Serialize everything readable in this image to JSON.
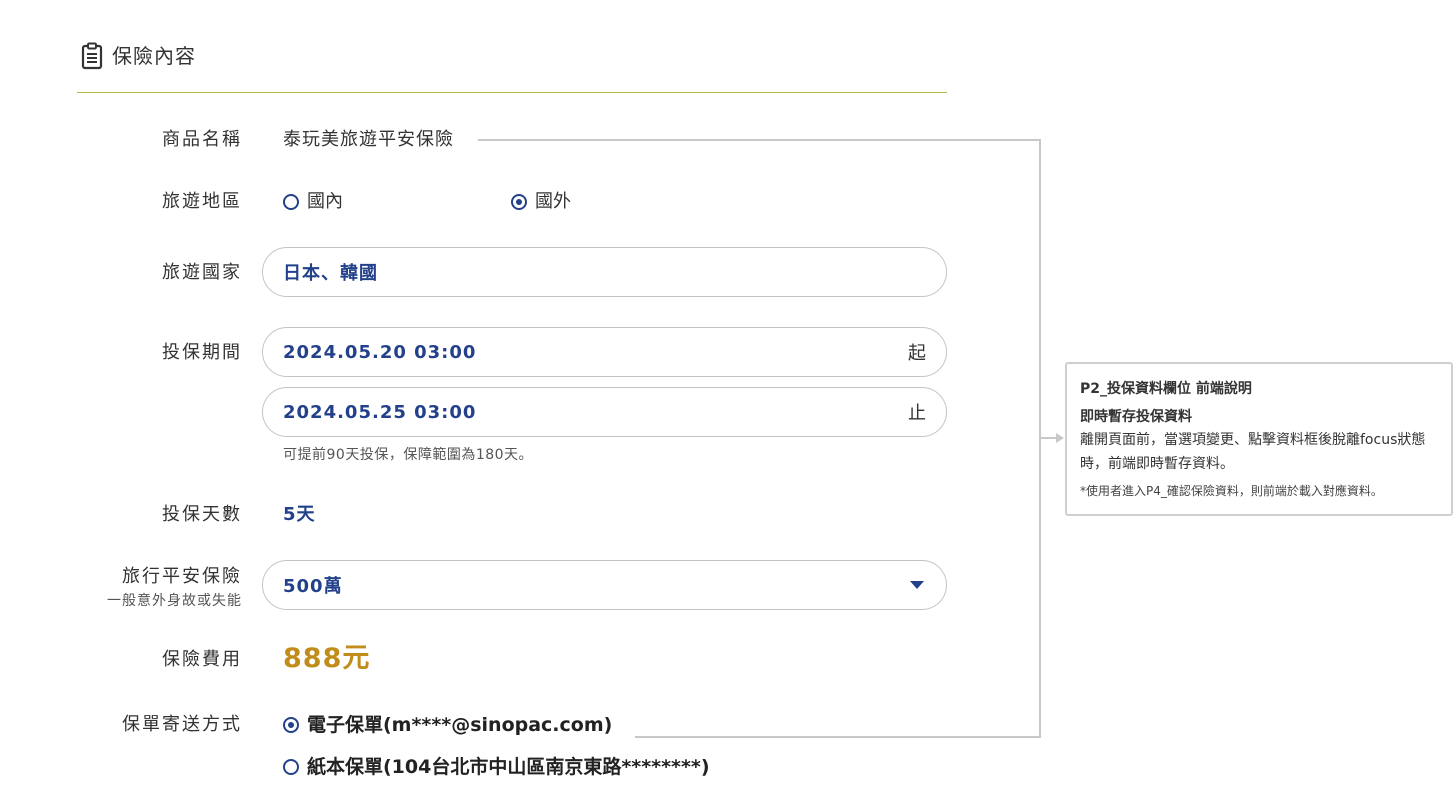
{
  "section": {
    "title": "保險內容",
    "icon": "clipboard-icon",
    "rule_color": "#b9b948"
  },
  "form": {
    "product": {
      "label": "商品名稱",
      "value": "泰玩美旅遊平安保險"
    },
    "region": {
      "label": "旅遊地區",
      "options": [
        {
          "label": "國內",
          "checked": false
        },
        {
          "label": "國外",
          "checked": true
        }
      ]
    },
    "country": {
      "label": "旅遊國家",
      "value": "日本、韓國"
    },
    "period": {
      "label": "投保期間",
      "start": {
        "value": "2024.05.20 03:00",
        "suffix": "起"
      },
      "end": {
        "value": "2024.05.25 03:00",
        "suffix": "止"
      },
      "hint": "可提前90天投保，保障範圍為180天。"
    },
    "days": {
      "label": "投保天數",
      "value": "5天"
    },
    "accident": {
      "label": "旅行平安保險",
      "sublabel": "一般意外身故或失能",
      "value": "500萬",
      "icon": "caret-down-icon"
    },
    "fee": {
      "label": "保險費用",
      "value": "888元",
      "color": "#c08d1a"
    },
    "delivery": {
      "label": "保單寄送方式",
      "options": [
        {
          "label": "電子保單(m****@sinopac.com)",
          "checked": true
        },
        {
          "label": "紙本保單(104台北市中山區南京東路********)",
          "checked": false
        }
      ]
    }
  },
  "annotation": {
    "title": "P2_投保資料欄位 前端說明",
    "subtitle": "即時暫存投保資料",
    "body": "離開頁面前，當選項變更、點擊資料框後脫離focus狀態時，前端即時暫存資料。",
    "footnote": "*使用者進入P4_確認保險資料，則前端於載入對應資料。"
  },
  "colors": {
    "accent_blue": "#23418a",
    "border_gray": "#c4c4c4",
    "text": "#333333"
  }
}
